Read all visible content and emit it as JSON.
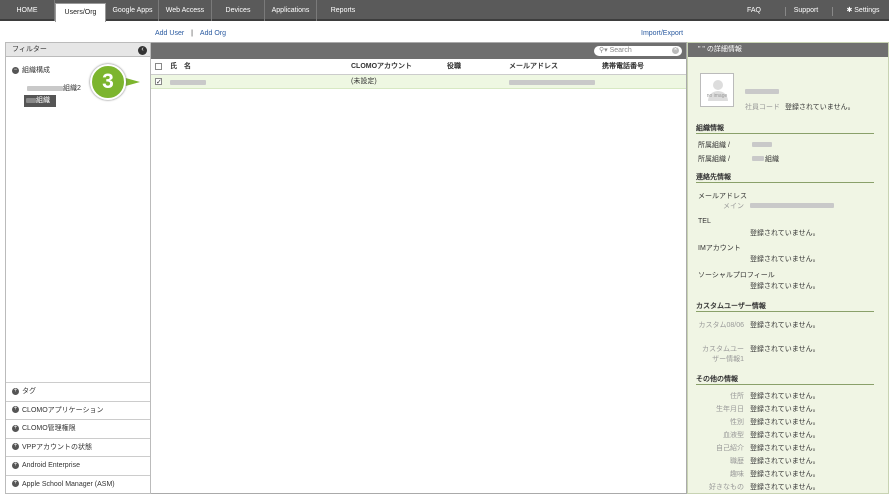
{
  "nav": {
    "tabs": [
      "HOME",
      "Users/Org",
      "Google Apps",
      "Web Access",
      "Devices",
      "Applications",
      "Reports"
    ],
    "active": "Users/Org",
    "right": [
      "FAQ",
      "Support",
      "Settings"
    ]
  },
  "actions": {
    "add_user": "Add User",
    "add_org": "Add Org",
    "import_export": "Import/Export"
  },
  "sidebar": {
    "filter_label": "フィルター",
    "close_icon": "×",
    "tree_root": "組織構成",
    "nodes": [
      {
        "label": "組織2"
      },
      {
        "label": "組織"
      }
    ],
    "categories": [
      "タグ",
      "CLOMOアプリケーション",
      "CLOMO管理権限",
      "VPPアカウントの状態",
      "Android Enterprise",
      "Apple School Manager (ASM)"
    ]
  },
  "search": {
    "placeholder": "Search"
  },
  "table": {
    "headers": [
      "氏　名",
      "CLOMOアカウント",
      "役職",
      "メールアドレス",
      "携帯電話番号"
    ],
    "rows": [
      {
        "name": "",
        "account": "(未設定)",
        "role": "",
        "email": "",
        "phone": "",
        "checked": true
      }
    ]
  },
  "badge": "3",
  "detail": {
    "title": "\" \" の詳細情報",
    "avatar_text": "no image",
    "employee_label": "社員コード",
    "not_registered": "登録されていません。",
    "org_section": "組織情報",
    "org_lines": [
      "所属組織 /",
      "所属組織 /",
      "組織"
    ],
    "contact_section": "連絡先情報",
    "email_label": "メールアドレス",
    "main_label": "メイン",
    "tel_label": "TEL",
    "im_label": "IMアカウント",
    "social_label": "ソーシャルプロフィール",
    "custom_section": "カスタムユーザー情報",
    "custom_fields": [
      "カスタム08/06",
      "カスタムユーザー情報1"
    ],
    "other_section": "その他の情報",
    "other_fields": [
      "住所",
      "生年月日",
      "性別",
      "血液型",
      "自己紹介",
      "職歴",
      "趣味",
      "好きなもの"
    ]
  }
}
